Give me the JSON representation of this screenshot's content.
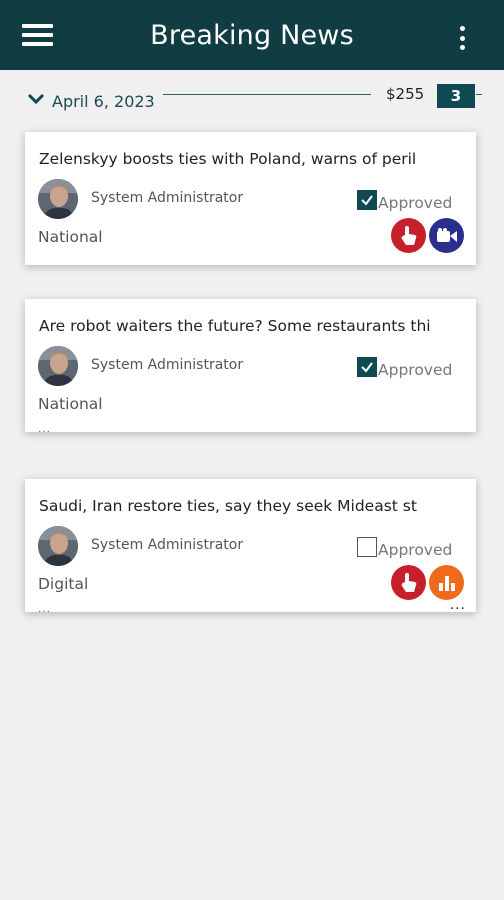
{
  "appbar": {
    "title": "Breaking News",
    "menu_icon": "hamburger-menu-icon",
    "more_icon": "vertical-ellipsis-icon",
    "color": "#0f3d42"
  },
  "group": {
    "date": "April 6, 2023",
    "amount": "$255",
    "count": "3",
    "toggle_icon": "chevron-down-icon"
  },
  "cards": [
    {
      "title": "Zelenskyy boosts ties with Poland, warns of peril",
      "author": "System Administrator",
      "approved": true,
      "approved_label": "Approved",
      "category": "National",
      "badges": [
        "hand-pointer-icon",
        "video-camera-icon"
      ],
      "ellipsis": ""
    },
    {
      "title": "Are robot waiters the future? Some restaurants thi",
      "author": "System Administrator",
      "approved": true,
      "approved_label": "Approved",
      "category": "National",
      "badges": [],
      "ellipsis": "..."
    },
    {
      "title": "Saudi, Iran restore ties, say they seek Mideast st",
      "author": "System Administrator",
      "approved": false,
      "approved_label": "Approved",
      "category": "Digital",
      "badges": [
        "hand-pointer-icon",
        "bar-chart-icon"
      ],
      "ellipsis": "...",
      "more": "..."
    }
  ]
}
